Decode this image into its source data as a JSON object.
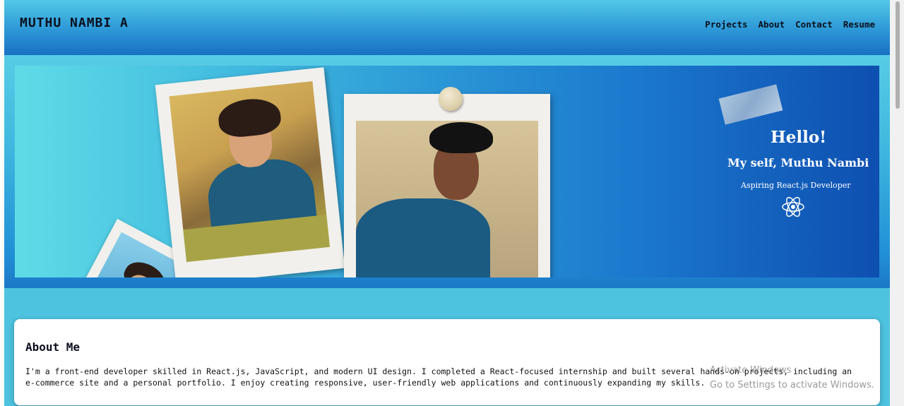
{
  "header": {
    "brand": "MUTHU NAMBI A",
    "nav": [
      "Projects",
      "About",
      "Contact",
      "Resume"
    ]
  },
  "hero": {
    "greeting": "Hello!",
    "intro": "My self, Muthu Nambi",
    "role": "Aspiring React.js Developer",
    "icon": "react-atom-icon"
  },
  "about": {
    "title": "About Me",
    "text": "I'm a front-end developer skilled in React.js, JavaScript, and modern UI design. I completed a React-focused internship and built several hands-on projects, including an e-commerce site and a personal portfolio. I enjoy creating responsive, user-friendly web applications and continuously expanding my skills."
  },
  "watermark": {
    "line1": "Activate Windows",
    "line2": "Go to Settings to activate Windows."
  },
  "colors": {
    "header_top": "#52c8e6",
    "header_bottom": "#1a70c4",
    "hero_left": "#5fdbe7",
    "hero_right": "#0e4fb0",
    "page_bg": "#4ec3e0"
  }
}
